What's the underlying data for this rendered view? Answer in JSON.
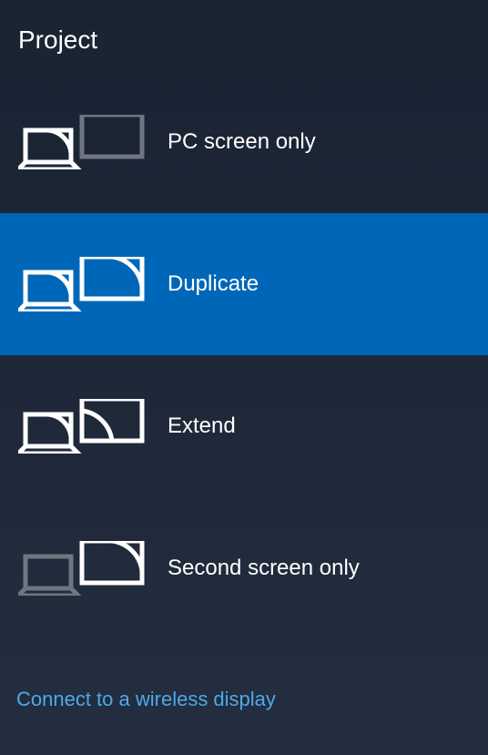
{
  "header": {
    "title": "Project"
  },
  "options": [
    {
      "id": "pc-screen-only",
      "label": "PC screen only",
      "selected": false
    },
    {
      "id": "duplicate",
      "label": "Duplicate",
      "selected": true
    },
    {
      "id": "extend",
      "label": "Extend",
      "selected": false
    },
    {
      "id": "second-screen-only",
      "label": "Second screen only",
      "selected": false
    }
  ],
  "footer": {
    "wireless_link": "Connect to a wireless display"
  }
}
